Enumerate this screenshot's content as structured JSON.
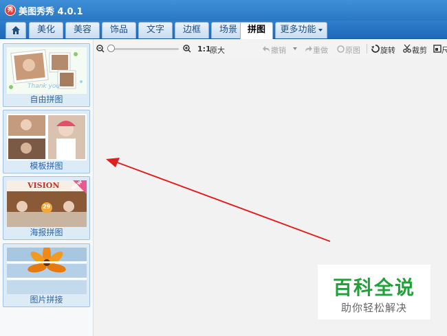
{
  "app": {
    "title": "美图秀秀 4.0.1",
    "logo_text": "秀"
  },
  "tabs": [
    {
      "label": "美化"
    },
    {
      "label": "美容"
    },
    {
      "label": "饰品"
    },
    {
      "label": "文字"
    },
    {
      "label": "边框"
    },
    {
      "label": "场景"
    },
    {
      "label": "拼图"
    },
    {
      "label": "更多功能"
    }
  ],
  "toolbar": {
    "zoom_ratio": "1:1",
    "zoom_label": "原大",
    "undo": "撤销",
    "redo": "重做",
    "original": "原图",
    "rotate": "旋转",
    "crop": "裁剪",
    "resize": "尺"
  },
  "collage_modes": [
    {
      "label": "自由拼图",
      "thumb_text": "Thank you"
    },
    {
      "label": "模板拼图"
    },
    {
      "label": "海报拼图",
      "thumb_text": "VISION",
      "badge": "new",
      "poster_number": "29"
    },
    {
      "label": "图片拼接"
    }
  ],
  "watermark": {
    "title": "百科全说",
    "subtitle": "助你轻松解决"
  },
  "colors": {
    "titlebar": "#2a78c4",
    "arrow": "#e02020",
    "watermark_green": "#1fa23a"
  }
}
